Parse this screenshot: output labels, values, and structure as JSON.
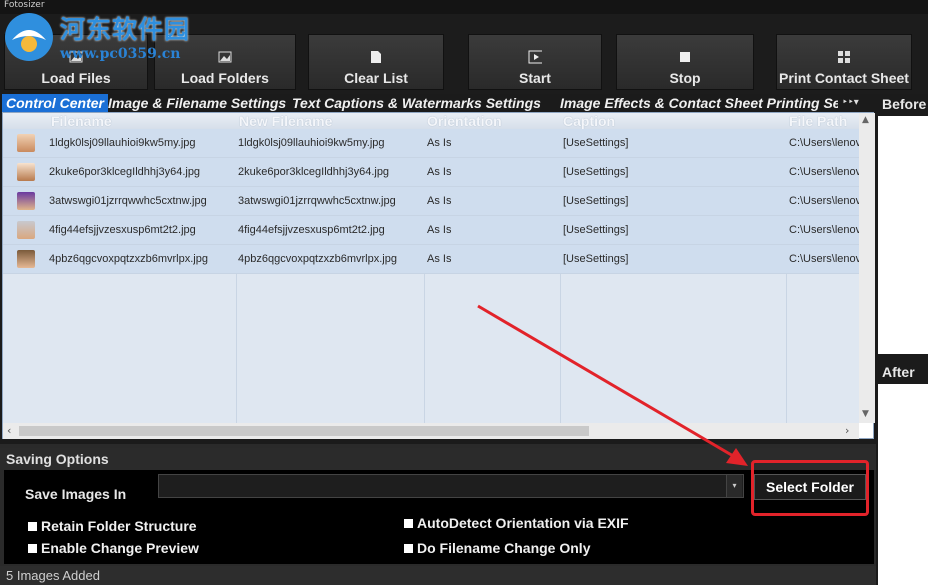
{
  "window": {
    "title": "Fotosizer"
  },
  "watermark": {
    "title": "河东软件园",
    "url": "www.pc0359.cn"
  },
  "toolbar": {
    "load_files": "Load Files",
    "load_folders": "Load Folders",
    "clear_list": "Clear List",
    "start": "Start",
    "stop": "Stop",
    "print_contact_sheet": "Print Contact Sheet"
  },
  "tabs": [
    "Control Center",
    "Image & Filename Settings",
    "Text Captions & Watermarks Settings",
    "Image Effects & Contact Sheet Printing Se"
  ],
  "grid": {
    "columns": [
      "Filename",
      "New Filename",
      "Orientation",
      "Caption",
      "File Path"
    ],
    "rows": [
      {
        "filename": "1ldgk0lsj09llauhioi9kw5my.jpg",
        "new_filename": "1ldgk0lsj09llauhioi9kw5my.jpg",
        "orientation": "As Is",
        "caption": "[UseSettings]",
        "path": "C:\\Users\\lenov"
      },
      {
        "filename": "2kuke6por3klcegIldhhj3y64.jpg",
        "new_filename": "2kuke6por3klcegIldhhj3y64.jpg",
        "orientation": "As Is",
        "caption": "[UseSettings]",
        "path": "C:\\Users\\lenov"
      },
      {
        "filename": "3atwswgi01jzrrqwwhc5cxtnw.jpg",
        "new_filename": "3atwswgi01jzrrqwwhc5cxtnw.jpg",
        "orientation": "As Is",
        "caption": "[UseSettings]",
        "path": "C:\\Users\\lenov"
      },
      {
        "filename": "4fig44efsjjvzesxusp6mt2t2.jpg",
        "new_filename": "4fig44efsjjvzesxusp6mt2t2.jpg",
        "orientation": "As Is",
        "caption": "[UseSettings]",
        "path": "C:\\Users\\lenov"
      },
      {
        "filename": "4pbz6qgcvoxpqtzxzb6mvrlpx.jpg",
        "new_filename": "4pbz6qgcvoxpqtzxzb6mvrlpx.jpg",
        "orientation": "As Is",
        "caption": "[UseSettings]",
        "path": "C:\\Users\\lenov"
      }
    ]
  },
  "preview": {
    "before": "Before",
    "after": "After"
  },
  "saving": {
    "header": "Saving Options",
    "save_images_in": "Save Images In",
    "folder_value": "",
    "select_folder": "Select Folder",
    "retain_folder_structure": "Retain Folder Structure",
    "enable_change_preview": "Enable Change Preview",
    "autodetect_orientation": "AutoDetect Orientation via EXIF",
    "filename_change_only": "Do Filename Change Only"
  },
  "status": {
    "text": "5 Images Added"
  },
  "colors": {
    "accent_tab": "#1a6fd6",
    "annotation_red": "#e2232a"
  }
}
